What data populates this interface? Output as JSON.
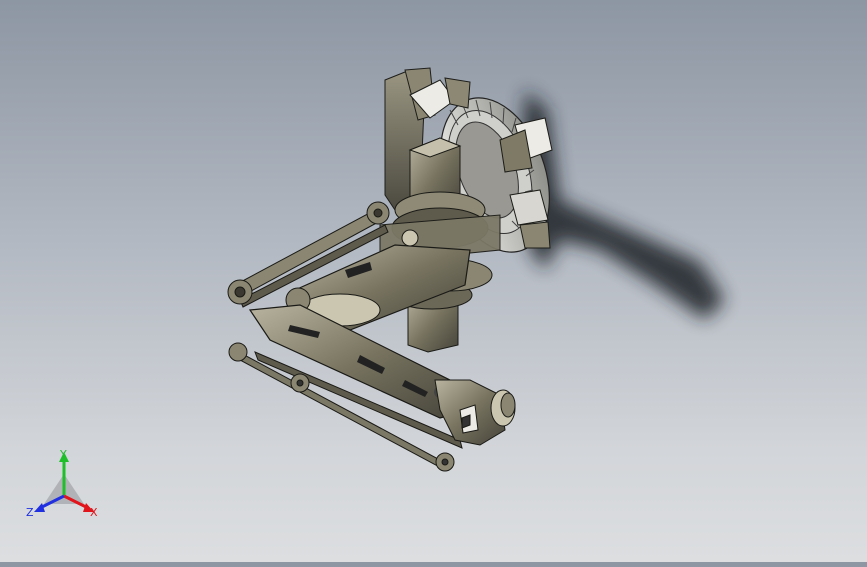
{
  "viewport": {
    "model": "robot-arm-assembly",
    "render_style": "shaded-with-edges"
  },
  "triad": {
    "x_label": "X",
    "y_label": "Y",
    "z_label": "Z",
    "x_color": "#e0141a",
    "y_color": "#1fbf2a",
    "z_color": "#2030e0"
  },
  "colors": {
    "metal": "#6f6c5c",
    "metal_light": "#a4a08c",
    "metal_dark": "#3a3830",
    "shadow": "#1c1f24"
  }
}
